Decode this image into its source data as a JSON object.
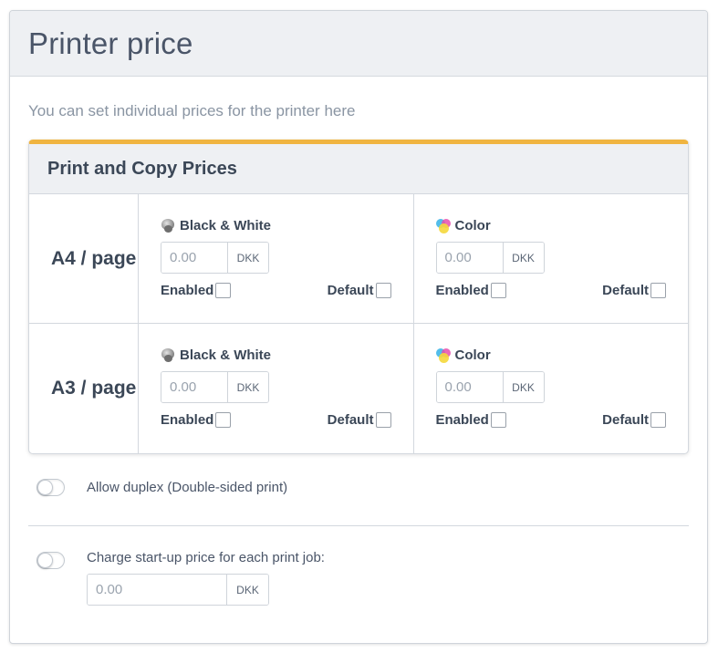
{
  "panel": {
    "title": "Printer price",
    "description": "You can set individual prices for the printer here"
  },
  "card": {
    "title": "Print and Copy Prices",
    "rows": [
      {
        "label": "A4 / page",
        "cells": [
          {
            "name": "Black & White",
            "icon": "bw-ink-icon",
            "value": "",
            "placeholder": "0.00",
            "currency": "DKK",
            "enabled_label": "Enabled",
            "default_label": "Default"
          },
          {
            "name": "Color",
            "icon": "color-ink-icon",
            "value": "",
            "placeholder": "0.00",
            "currency": "DKK",
            "enabled_label": "Enabled",
            "default_label": "Default"
          }
        ]
      },
      {
        "label": "A3 / page",
        "cells": [
          {
            "name": "Black & White",
            "icon": "bw-ink-icon",
            "value": "",
            "placeholder": "0.00",
            "currency": "DKK",
            "enabled_label": "Enabled",
            "default_label": "Default"
          },
          {
            "name": "Color",
            "icon": "color-ink-icon",
            "value": "",
            "placeholder": "0.00",
            "currency": "DKK",
            "enabled_label": "Enabled",
            "default_label": "Default"
          }
        ]
      }
    ]
  },
  "duplex": {
    "label": "Allow duplex (Double-sided print)",
    "enabled": false
  },
  "startup": {
    "label": "Charge start-up price for each print job:",
    "enabled": false,
    "placeholder": "0.00",
    "currency": "DKK"
  },
  "colors": {
    "accent": "#f0b440",
    "header_bg": "#eef0f3",
    "border": "#d3d8de",
    "text": "#3b4757",
    "muted": "#8a95a3"
  }
}
